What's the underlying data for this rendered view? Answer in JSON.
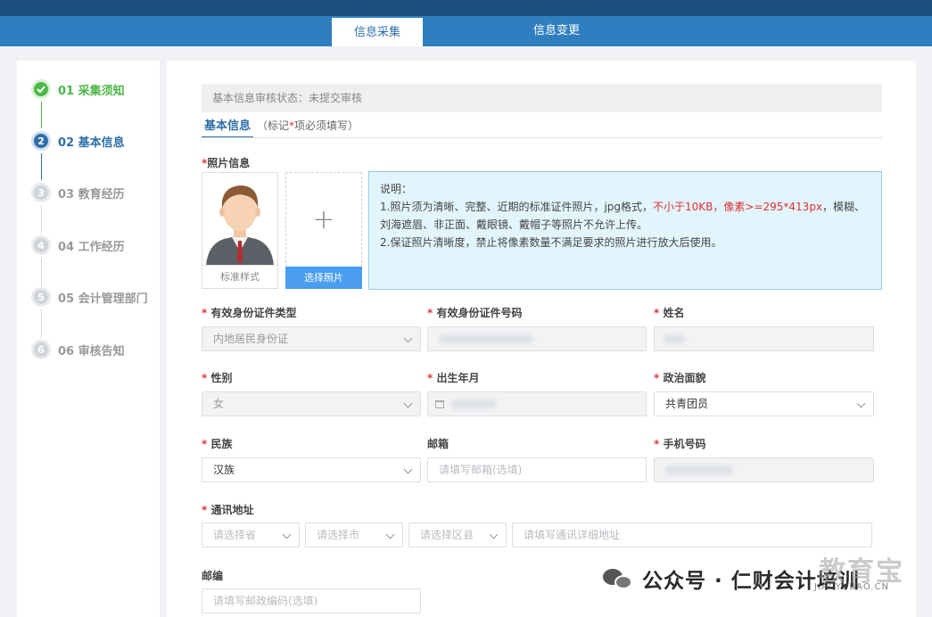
{
  "tabs": [
    {
      "label": "信息采集"
    },
    {
      "label": "信息变更"
    }
  ],
  "steps": [
    {
      "label": "01 采集须知",
      "status": "done"
    },
    {
      "label": "02 基本信息",
      "status": "current",
      "num": "2"
    },
    {
      "label": "03 教育经历",
      "status": "pending",
      "num": "3"
    },
    {
      "label": "04 工作经历",
      "status": "pending",
      "num": "4"
    },
    {
      "label": "05 会计管理部门",
      "status": "pending",
      "num": "5"
    },
    {
      "label": "06 审核告知",
      "status": "pending",
      "num": "6"
    }
  ],
  "status_text": "基本信息审核状态：未提交审核",
  "subtab": {
    "label": "基本信息",
    "hint_pre": "（标记",
    "hint_star": "*",
    "hint_post": "项必须填写）"
  },
  "photo": {
    "label": "照片信息",
    "sample_caption": "标准样式",
    "choose_button": "选择照片",
    "note_title": "说明：",
    "note_line1_pre": "1.照片须为清晰、完整、近期的标准证件照片，jpg格式，",
    "note_line1_red": "不小于10KB，像素>=295*413px",
    "note_line1_post": "，模糊、刘海遮眉、非正面、戴眼镜、戴帽子等照片不允许上传。",
    "note_line2": "2.保证照片清晰度，禁止将像素数量不满足要求的照片进行放大后使用。"
  },
  "fields": {
    "id_type": {
      "label": "有效身份证件类型",
      "value": "内地居民身份证"
    },
    "id_number": {
      "label": "有效身份证件号码"
    },
    "name": {
      "label": "姓名"
    },
    "gender": {
      "label": "性别",
      "value": "女"
    },
    "birth": {
      "label": "出生年月"
    },
    "political": {
      "label": "政治面貌",
      "value": "共青团员"
    },
    "ethnicity": {
      "label": "民族",
      "value": "汉族"
    },
    "email": {
      "label": "邮箱",
      "placeholder": "请填写邮箱(选填)"
    },
    "phone": {
      "label": "手机号码"
    },
    "address": {
      "label": "通讯地址",
      "province_placeholder": "请选择省",
      "city_placeholder": "请选择市",
      "district_placeholder": "请选择区县",
      "detail_placeholder": "请填写通讯详细地址"
    },
    "postcode": {
      "label": "邮编",
      "placeholder": "请填写邮政编码(选填)"
    }
  },
  "watermark": {
    "text": "公众号 · 仁财会计培训",
    "overlay": "教育宝",
    "overlay_url": "JIAOYUBAO.CN"
  },
  "colors": {
    "accent": "#2f7fc0",
    "done": "#4cb848",
    "required": "#e0393e"
  }
}
